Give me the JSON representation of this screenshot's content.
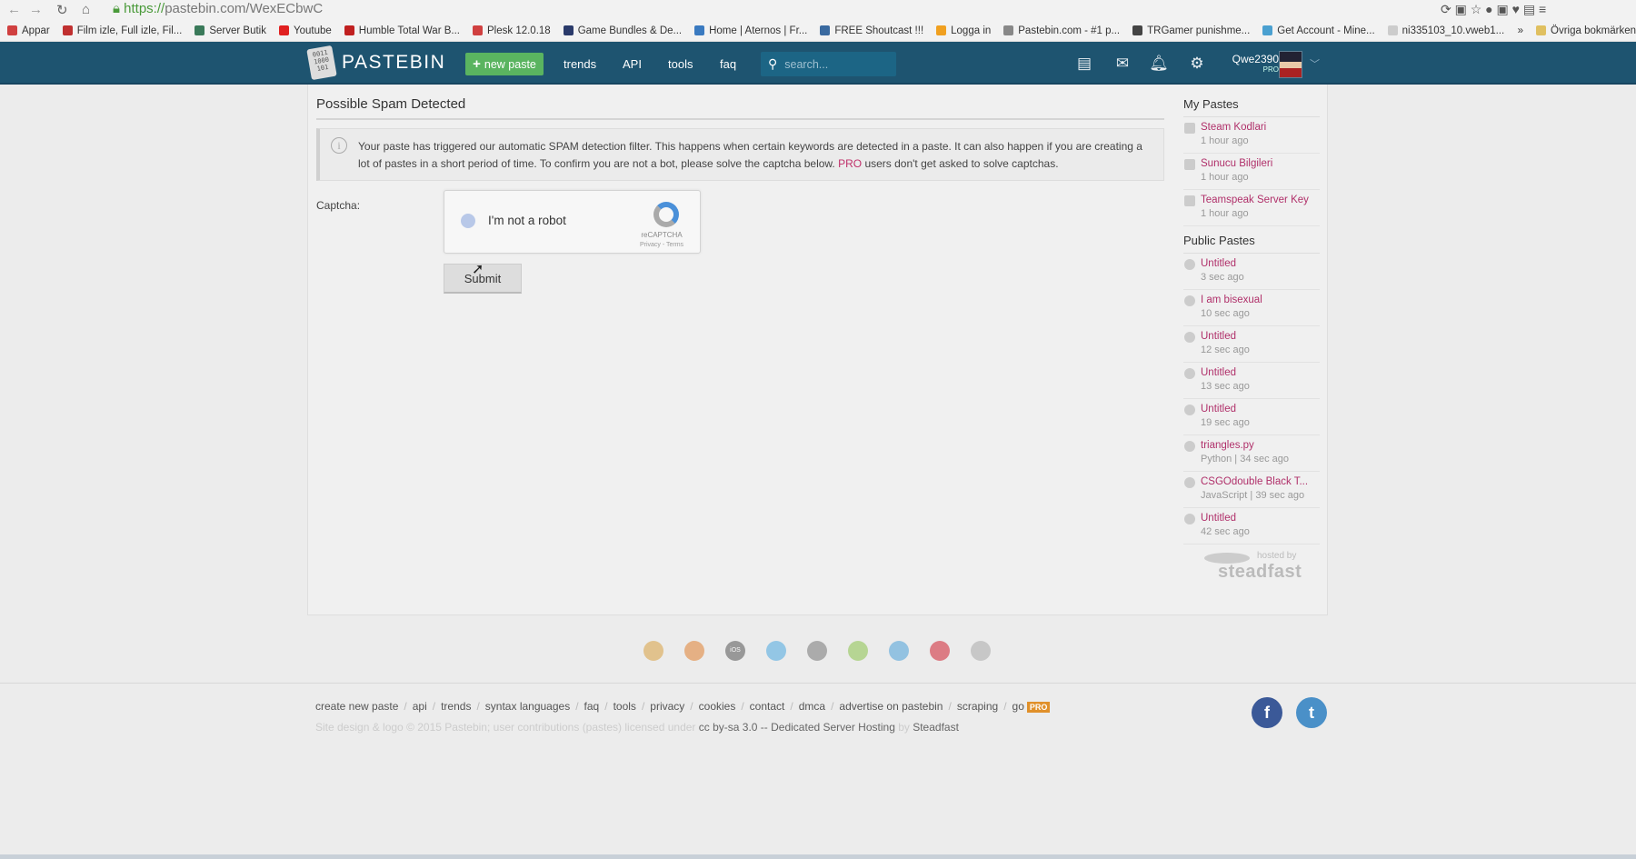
{
  "browser": {
    "url_scheme": "https://",
    "url_rest": "pastebin.com/WexECbwC",
    "bookmarks": [
      {
        "label": "Appar",
        "color": "#d04040"
      },
      {
        "label": "Film izle, Full izle, Fil...",
        "color": "#c03030"
      },
      {
        "label": "Server Butik",
        "color": "#3a7a5a"
      },
      {
        "label": "Youtube",
        "color": "#e02020"
      },
      {
        "label": "Humble Total War B...",
        "color": "#c02020"
      },
      {
        "label": "Plesk 12.0.18",
        "color": "#d04040"
      },
      {
        "label": "Game Bundles & De...",
        "color": "#2a3a6a"
      },
      {
        "label": "Home | Aternos | Fr...",
        "color": "#3a7ac0"
      },
      {
        "label": "FREE Shoutcast !!!",
        "color": "#3a6aa0"
      },
      {
        "label": "Logga in",
        "color": "#f0a020"
      },
      {
        "label": "Pastebin.com - #1 p...",
        "color": "#888888"
      },
      {
        "label": "TRGamer punishme...",
        "color": "#444444"
      },
      {
        "label": "Get Account - Mine...",
        "color": "#4aa0d0"
      },
      {
        "label": "ni335103_10.vweb1...",
        "color": "#cccccc"
      },
      {
        "label": "»",
        "color": ""
      },
      {
        "label": "Övriga bokmärken",
        "color": "#e0c060"
      }
    ]
  },
  "header": {
    "logo": "PASTEBIN",
    "logo_digits": "0011 1000 101",
    "new_paste": "new paste",
    "nav": [
      "trends",
      "API",
      "tools",
      "faq"
    ],
    "search_placeholder": "search...",
    "username": "Qwe2390",
    "badge": "PRO"
  },
  "main": {
    "title": "Possible Spam Detected",
    "alert_before": "Your paste has triggered our automatic SPAM detection filter. This happens when certain keywords are detected in a paste. It can also happen if you are creating a lot of pastes in a short period of time. To confirm you are not a bot, please solve the captcha below. ",
    "alert_link": "PRO",
    "alert_after": " users don't get asked to solve captchas.",
    "captcha_label": "Captcha:",
    "recaptcha": {
      "checkbox_label": "I'm not a robot",
      "brand": "reCAPTCHA",
      "links": "Privacy - Terms"
    },
    "submit": "Submit"
  },
  "sidebar": {
    "my_title": "My Pastes",
    "my": [
      {
        "title": "Steam Kodlari",
        "meta": "1 hour ago"
      },
      {
        "title": "Sunucu Bilgileri",
        "meta": "1 hour ago"
      },
      {
        "title": "Teamspeak Server Key",
        "meta": "1 hour ago"
      }
    ],
    "public_title": "Public Pastes",
    "public": [
      {
        "title": "Untitled",
        "meta": "3 sec ago"
      },
      {
        "title": "I am bisexual",
        "meta": "10 sec ago"
      },
      {
        "title": "Untitled",
        "meta": "12 sec ago"
      },
      {
        "title": "Untitled",
        "meta": "13 sec ago"
      },
      {
        "title": "Untitled",
        "meta": "19 sec ago"
      },
      {
        "title": "triangles.py",
        "meta": "Python | 34 sec ago"
      },
      {
        "title": "CSGOdouble Black T...",
        "meta": "JavaScript | 39 sec ago"
      },
      {
        "title": "Untitled",
        "meta": "42 sec ago"
      }
    ],
    "hosted_by": "hosted by",
    "host": "steadfast"
  },
  "apps": [
    {
      "name": "chrome",
      "color": "#d9a040"
    },
    {
      "name": "firefox",
      "color": "#e08030"
    },
    {
      "name": "ios",
      "color": "#555555",
      "text": "iOS"
    },
    {
      "name": "windows",
      "color": "#4aa8e0"
    },
    {
      "name": "macos",
      "color": "#777777"
    },
    {
      "name": "android",
      "color": "#8bc34a"
    },
    {
      "name": "x",
      "color": "#4aa0d8"
    },
    {
      "name": "opera",
      "color": "#d02030"
    },
    {
      "name": "other",
      "color": "#aaaaaa"
    }
  ],
  "footer": {
    "links": [
      "create new paste",
      "api",
      "trends",
      "syntax languages",
      "faq",
      "tools",
      "privacy",
      "cookies",
      "contact",
      "dmca",
      "advertise on pastebin",
      "scraping"
    ],
    "go": "go",
    "go_badge": "PRO",
    "copy1": "Site design & logo © 2015 Pastebin; user contributions (pastes) licensed under ",
    "copy_link": "cc by-sa 3.0",
    "copy2": " -- Dedicated Server Hosting",
    "copy3": " by ",
    "copy_host": "Steadfast",
    "facebook": "f",
    "twitter": "t",
    "facebook_color": "#3b5998",
    "twitter_color": "#4a90c8"
  }
}
